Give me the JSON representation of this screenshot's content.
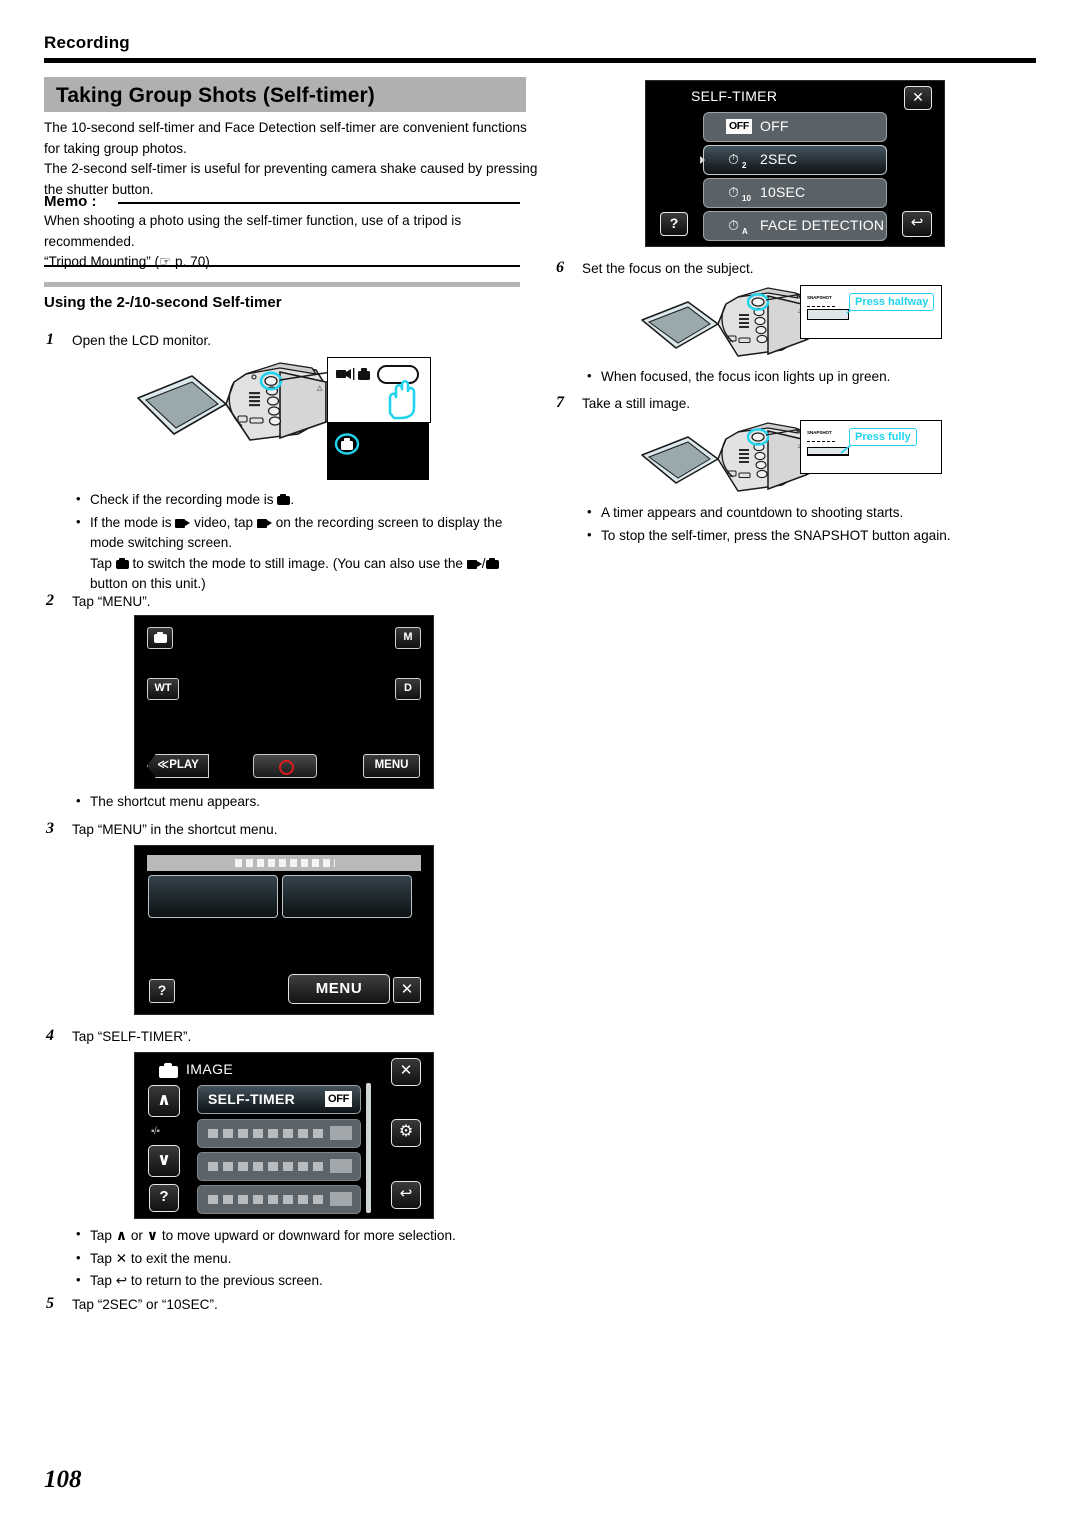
{
  "header": {
    "chapter": "Recording",
    "title": "Taking Group Shots (Self-timer)"
  },
  "intro": {
    "paragraph1": "The 10-second self-timer and Face Detection self-timer are convenient functions for taking group photos.",
    "paragraph2": "The 2-second self-timer is useful for preventing camera shake caused by pressing the shutter button."
  },
  "memo": {
    "label": "Memo :",
    "text": "When shooting a photo using the self-timer function, use of a tripod is recommended.",
    "reference": "“Tripod Mounting” (☞ p. 70)"
  },
  "section": {
    "title": "Using the 2-/10-second Self-timer"
  },
  "steps": {
    "s1": {
      "num": "1",
      "text": "Open the LCD monitor."
    },
    "s1_bullets": {
      "b1_pre": "Check if the recording mode is",
      "b1_post": ".",
      "b2_a": "If the mode is",
      "b2_b": "video, tap",
      "b2_c": "on the recording screen to display the mode switching screen.",
      "b2_d": "Tap",
      "b2_e": "to switch the mode to still image. (You can also use the",
      "b2_f": "/",
      "b2_g": "button on this unit.)"
    },
    "s2": {
      "num": "2",
      "text": "Tap “MENU”."
    },
    "s2_bullet": "The shortcut menu appears.",
    "s3": {
      "num": "3",
      "text": "Tap “MENU” in the shortcut menu."
    },
    "s4": {
      "num": "4",
      "text": "Tap “SELF-TIMER”."
    },
    "s4_bullets": {
      "b1_a": "Tap",
      "b1_b": "or",
      "b1_c": "to move upward or downward for more selection.",
      "b2_a": "Tap",
      "b2_b": "to exit the menu.",
      "b3_a": "Tap",
      "b3_b": "to return to the previous screen."
    },
    "s5": {
      "num": "5",
      "text": "Tap “2SEC” or “10SEC”."
    },
    "s6": {
      "num": "6",
      "text": "Set the focus on the subject."
    },
    "s6_bullet": "When focused, the focus icon lights up in green.",
    "s7": {
      "num": "7",
      "text": "Take a still image."
    },
    "s7_bullets": {
      "b1": "A timer appears and countdown to shooting starts.",
      "b2": "To stop the self-timer, press the SNAPSHOT button again."
    }
  },
  "icons": {
    "up_arrow": "∧",
    "down_arrow": "∨",
    "close_x": "✕",
    "back_arrow": "↩",
    "question": "?",
    "gear": "⚙"
  },
  "lcd_step2": {
    "still_mode_icon": "still-image-icon",
    "manual_badge": "M",
    "zoom_badge": "WT",
    "display_badge": "D",
    "play_label": "≪PLAY",
    "record_label": "record-button",
    "menu_label": "MENU"
  },
  "lcd_step3": {
    "question_label": "?",
    "menu_label": "MENU",
    "close_label": "✕"
  },
  "lcd_step4": {
    "title": "IMAGE",
    "close_label": "✕",
    "up_label": "∧",
    "down_label": "∨",
    "question_label": "?",
    "gear_label": "⚙",
    "back_label": "↩",
    "half_label": "▪/▪",
    "rows": [
      {
        "label": "SELF-TIMER",
        "value": "OFF",
        "selected": true
      },
      {
        "label": "",
        "value": "",
        "selected": false
      },
      {
        "label": "",
        "value": "",
        "selected": false
      },
      {
        "label": "",
        "value": "",
        "selected": false
      }
    ]
  },
  "lcd_selftimer": {
    "title": "SELF-TIMER",
    "close_label": "✕",
    "question_label": "?",
    "back_label": "↩",
    "options": [
      {
        "label": "OFF",
        "badge": "OFF",
        "selected": false
      },
      {
        "label": "2SEC",
        "badge": "2",
        "selected": true
      },
      {
        "label": "10SEC",
        "badge": "10",
        "selected": false
      },
      {
        "label": "FACE DETECTION",
        "badge": "A",
        "selected": false
      }
    ]
  },
  "callouts": {
    "mode_button": "video-still-mode-button",
    "snapshot_label": "SNAPSHOT",
    "press_halfway": "Press halfway",
    "press_fully": "Press fully"
  },
  "footer": {
    "page_number": "108"
  },
  "colors": {
    "band_gray": "#b0b0b0",
    "cyan_accent": "#22d3ee",
    "record_red": "#e01b1b",
    "lcd_black": "#000000"
  }
}
